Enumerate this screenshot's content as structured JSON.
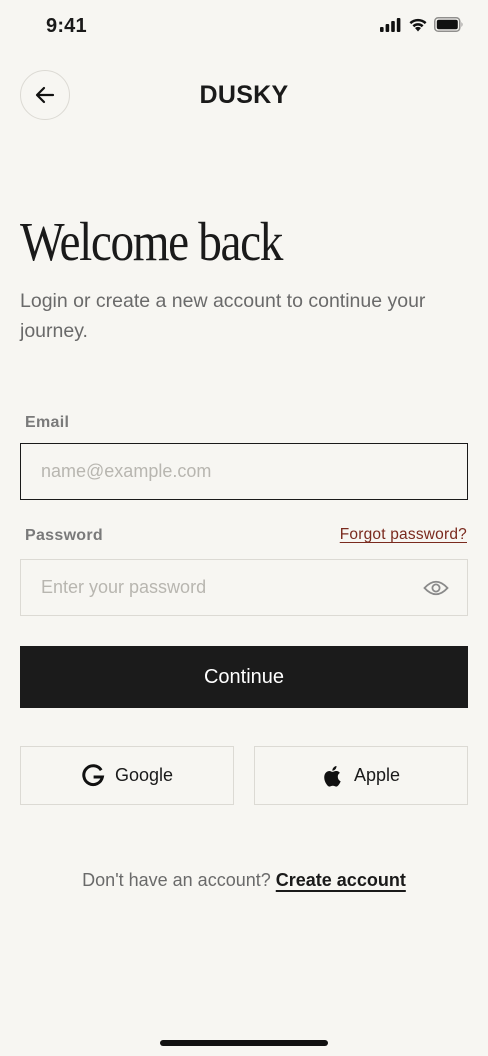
{
  "status_bar": {
    "time": "9:41"
  },
  "header": {
    "brand": "DUSKY"
  },
  "intro": {
    "title": "Welcome back",
    "subtitle": "Login or create a new account to continue your journey."
  },
  "form": {
    "email_label": "Email",
    "email_placeholder": "name@example.com",
    "email_value": "",
    "password_label": "Password",
    "password_placeholder": "Enter your password",
    "password_value": "",
    "forgot_label": "Forgot password?",
    "continue_label": "Continue"
  },
  "social": {
    "google_label": "Google",
    "google_icon": "google-logo-icon",
    "apple_label": "Apple",
    "apple_icon": "apple-logo-icon"
  },
  "footer": {
    "prompt": "Don't have an account?",
    "create_label": "Create account"
  },
  "colors": {
    "background": "#f7f6f2",
    "primary_button": "#1b1b1b",
    "link_accent": "#7a2a1e",
    "border": "#dcdad4"
  }
}
